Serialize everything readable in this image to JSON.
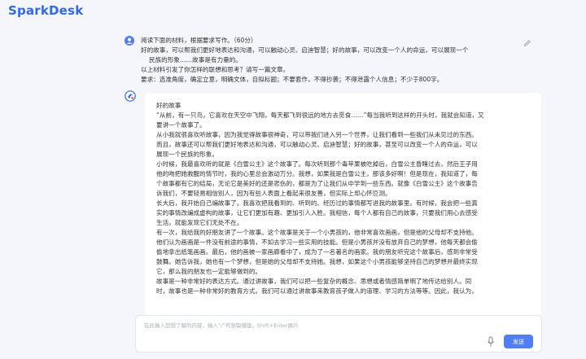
{
  "app": {
    "logo": "SparkDesk"
  },
  "user_message": {
    "lines": [
      "阅读下面的材料，根据要求写作。（60分）",
      "好的故事，可以帮我们更好地表达和沟通，可以触动心灵、启迪智慧；好的故事，可以改变一个人的命运，可以展现一个",
      "民族的形象……故事是有力量的。",
      "以上材料引发了你怎样的联想和思考？请写一篇文章。",
      "要求：选准角度，确定立意，明确文体，自拟标题；不要套作，不得抄袭；不得泄露个人信息；不少于800字。"
    ]
  },
  "answer": {
    "lines": [
      "好的故事",
      "“从前，有一只鸟，它喜欢在天空中飞翔，每天都飞到很远的地方去觅食……”每当我听到这样的开头时，我就会知道，又",
      "要讲一个故事了。",
      "从小我就很喜欢听故事，因为我觉得故事很神奇，可以带我们进入另一个世界，让我们看到一些我们从未见过的东西。",
      "而且，故事还可以帮我们更好地表达和沟通，可以触动心灵、启迪智慧；好的故事，甚至可以改变一个人的命运，可以",
      "展现一个民族的形象。",
      "小时候，我最喜欢听的就是《白雪公主》这个故事了。每次听到那个毒苹果被吃掉后，白雪公主昏睡过去，然后王子用",
      "他的吻把她救醒的情节时，我的心里总会激动万分。我想，如果我是白雪公主，那该多好啊！但是现在，我知道了，每",
      "个故事都有它的结局，无论它是美好的还是悲伤的，都是为了让我们从中学到一些东西。就像《白雪公主》这个故事告",
      "诉我们，不要轻易相信别人，因为有些人表面上看起来很友善，但实际上却心怀叵测。",
      "长大后，我开始自己编故事了。我喜欢把我看到的、听到的、经历过的事情都写进我的故事里。有时候，我会把一些真",
      "实的事情改编成虚构的故事，让它们更加有趣、更加引人入胜。我相信，每个人都有自己的故事，只要我们用心去感受",
      "生活，就能发现它们无处不在。",
      "有一次，我给我的好朋友讲了一个故事。这个故事是关于一个小男孩的，他非常喜欢画画，但是他的父母却不支持他。",
      "他们认为画画是一件没有前途的事情，不如去学习一些实用的技能。但是小男孩并没有放弃自己的梦想，他每天都会偷",
      "偷地拿出纸笔画画。最后，他的画被一家画廊看中了，成为了一名著名的画家。我的朋友听完这个故事后，感到非常受",
      "鼓舞。她告诉我，她也有一个梦想，但是她的父母却不支持她。我想，如果这个小男孩能够坚持自己的梦想并最终实现",
      "它，那么我的朋友也一定能够做到的。",
      "故事是一种非常好的表达方式。通过讲故事，我们可以把一些复杂的概念、思想或者情感简单明了地传达给别人。同",
      "时，故事也是一种非常好的教育方式。我们可以通过讲故事来教育孩子做人的道理、学习的方法等等。因此，我认为，"
    ]
  },
  "input": {
    "placeholder": "在此输入您想了解的内容，输入“/”可获取模版，Shift+Enter换行",
    "send_label": "发送"
  },
  "icons": {
    "user_avatar": "user-avatar-icon",
    "bot_avatar": "sparkdesk-avatar-icon",
    "edit": "pencil-icon",
    "mic": "microphone-icon"
  },
  "colors": {
    "brand": "#2f68f5",
    "send_button": "#4f7ef8",
    "background": "#f4f6fb"
  }
}
